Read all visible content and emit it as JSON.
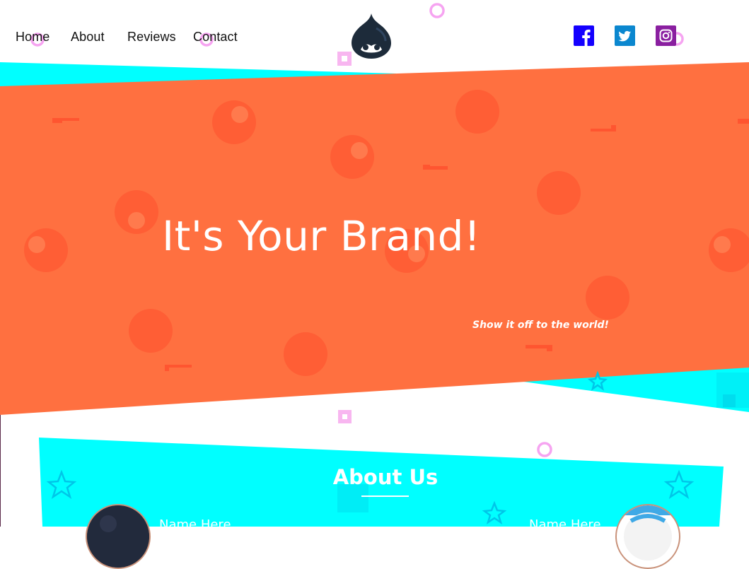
{
  "nav": {
    "links": [
      "Home",
      "About",
      "Reviews",
      "Contact"
    ]
  },
  "brand": {
    "logo_icon": "drupal-drop-icon"
  },
  "social": [
    {
      "name": "facebook-icon",
      "color": "#1400ff"
    },
    {
      "name": "twitter-icon",
      "color": "#0b87cf"
    },
    {
      "name": "instagram-icon",
      "color": "#8a1fa0"
    }
  ],
  "hero": {
    "title": "It's Your Brand!",
    "subtitle": "Show it off to the world!",
    "color": "#ff7040",
    "accent": "#00ffff"
  },
  "about": {
    "title": "About Us",
    "members": [
      {
        "name": "Name Here"
      },
      {
        "name": "Name Here"
      }
    ]
  }
}
